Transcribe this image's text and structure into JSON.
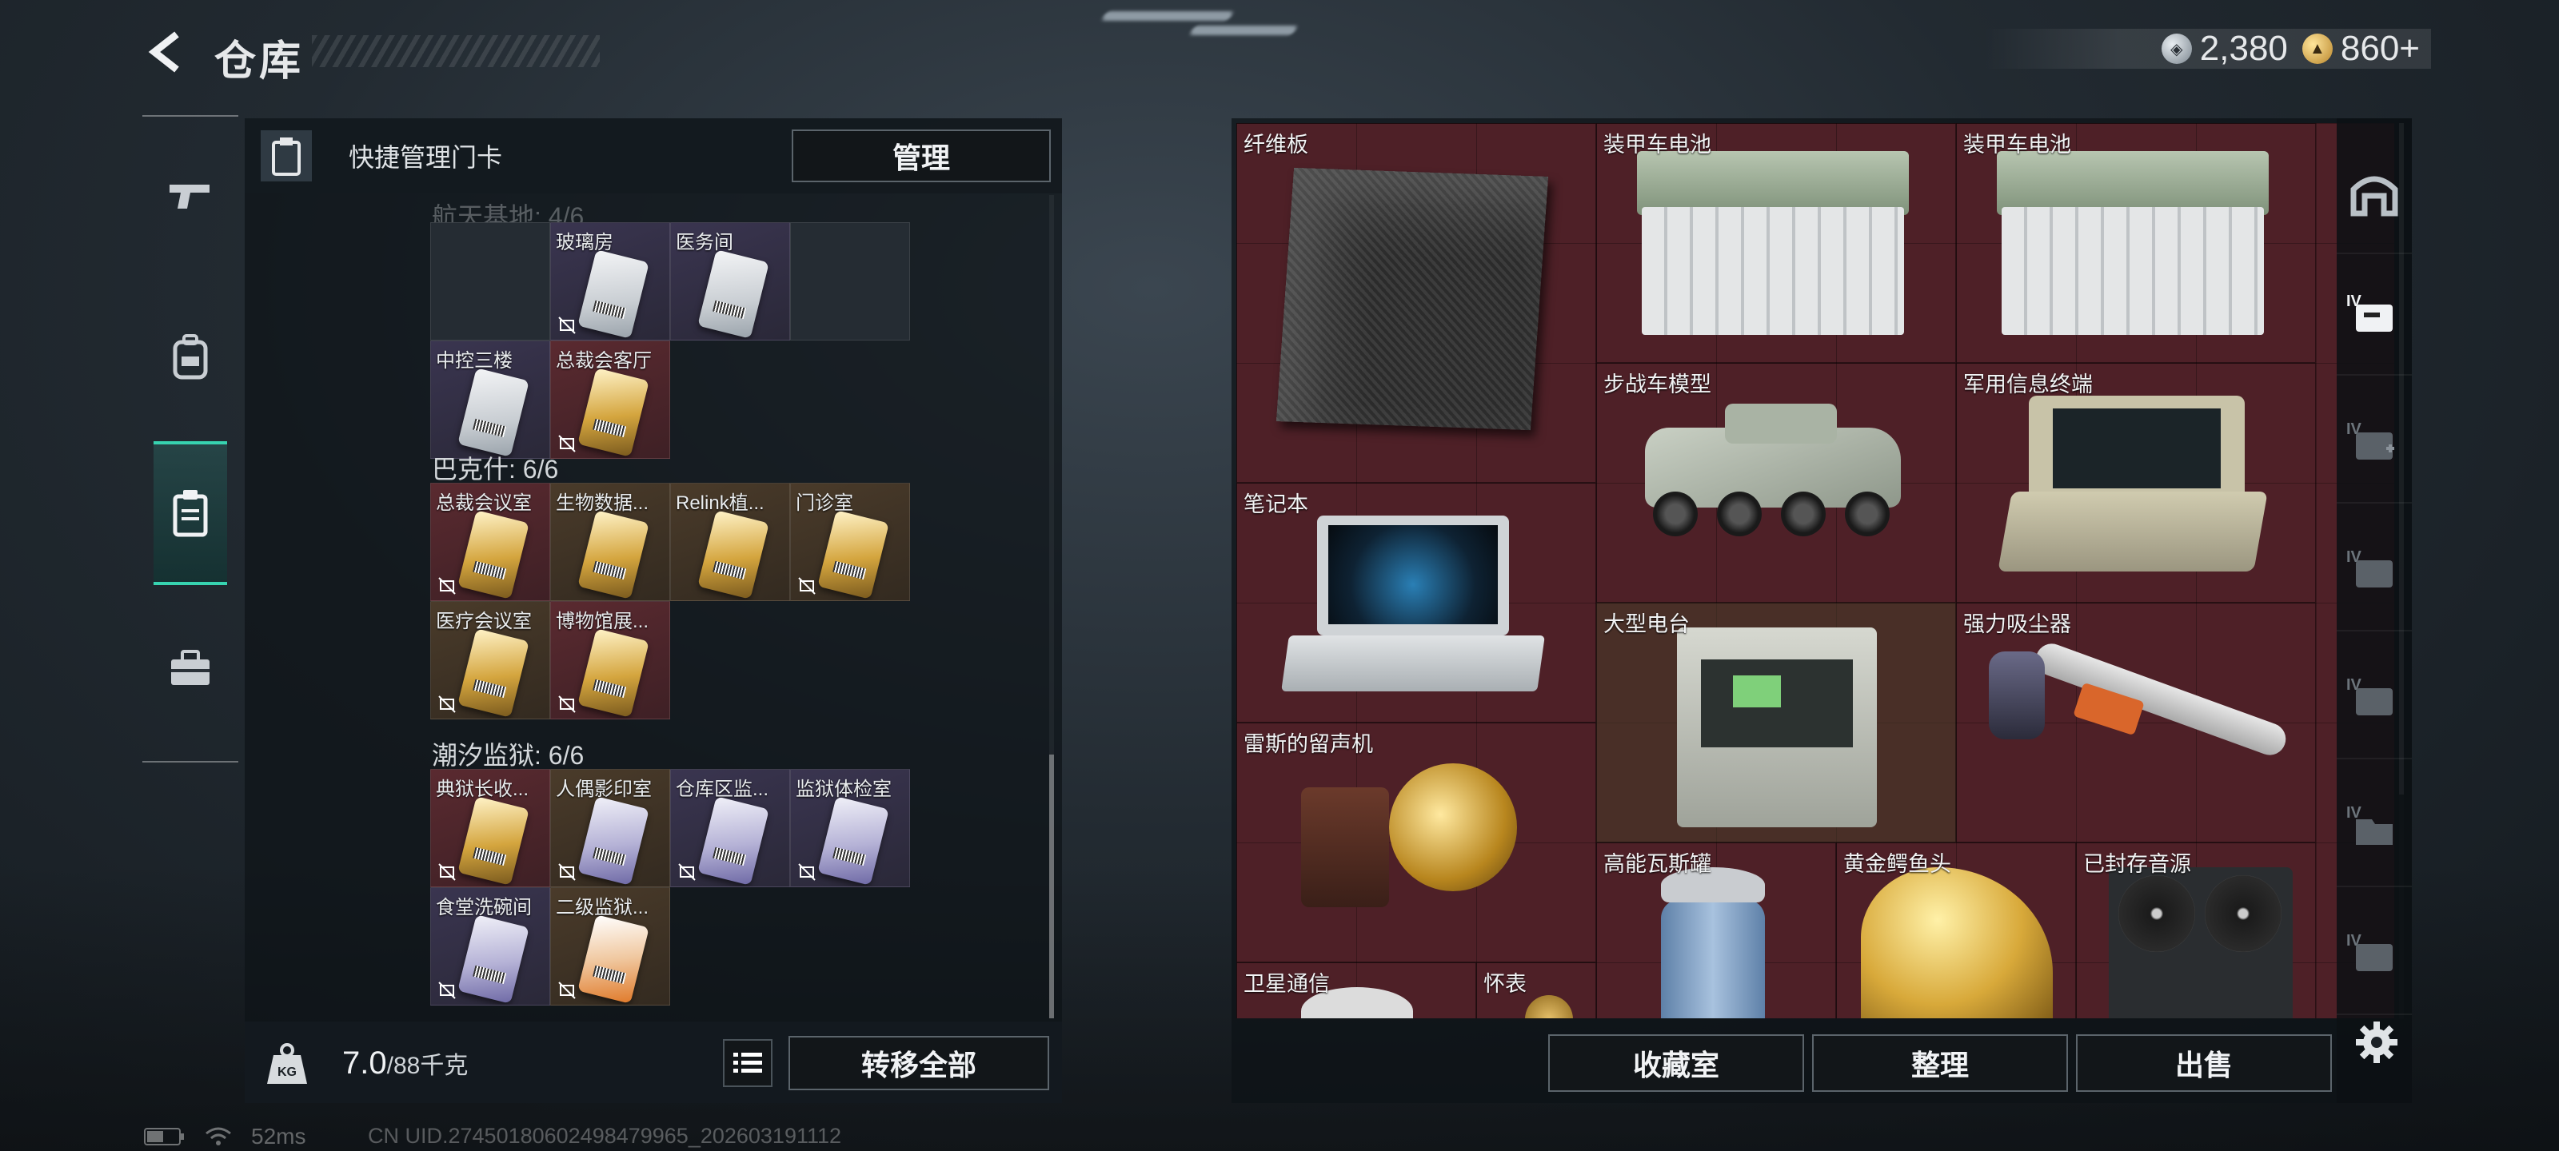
{
  "header": {
    "title": "仓库",
    "currencies": [
      {
        "icon": "silver-coin-icon",
        "value": "2,380"
      },
      {
        "icon": "gold-coin-icon",
        "value": "860+"
      }
    ]
  },
  "left_rail": {
    "tabs": [
      {
        "icon": "gun-icon",
        "active": false
      },
      {
        "icon": "backpack-icon",
        "active": false
      },
      {
        "icon": "keycard-holder-icon",
        "active": true
      },
      {
        "icon": "toolbox-icon",
        "active": false
      }
    ]
  },
  "left_panel": {
    "header_label": "快捷管理门卡",
    "manage_label": "管理",
    "partial_section_title": "航天基地: 4/6",
    "sections": [
      {
        "title": "",
        "cells": [
          {
            "name": "",
            "card": "",
            "bg": "empty",
            "lock": false
          },
          {
            "name": "玻璃房",
            "card": "white",
            "bg": "purple",
            "lock": true
          },
          {
            "name": "医务间",
            "card": "white",
            "bg": "purple",
            "lock": false
          },
          {
            "name": "",
            "card": "",
            "bg": "empty",
            "lock": false
          },
          {
            "name": "中控三楼",
            "card": "white",
            "bg": "purple",
            "lock": false
          },
          {
            "name": "总裁会客厅",
            "card": "gold",
            "bg": "red",
            "lock": true
          }
        ]
      },
      {
        "title": "巴克什: 6/6",
        "cells": [
          {
            "name": "总裁会议室",
            "card": "gold",
            "bg": "red",
            "lock": true
          },
          {
            "name": "生物数据...",
            "card": "gold",
            "bg": "gold",
            "lock": false
          },
          {
            "name": "Relink植...",
            "card": "gold",
            "bg": "gold",
            "lock": false
          },
          {
            "name": "门诊室",
            "card": "gold",
            "bg": "gold",
            "lock": true
          },
          {
            "name": "医疗会议室",
            "card": "gold",
            "bg": "gold",
            "lock": true
          },
          {
            "name": "博物馆展...",
            "card": "gold",
            "bg": "red",
            "lock": true
          }
        ]
      },
      {
        "title": "潮汐监狱: 6/6",
        "cells": [
          {
            "name": "典狱长收...",
            "card": "gold",
            "bg": "red",
            "lock": true
          },
          {
            "name": "人偶影印室",
            "card": "purple",
            "bg": "gold",
            "lock": true
          },
          {
            "name": "仓库区监...",
            "card": "purple",
            "bg": "purple",
            "lock": true
          },
          {
            "name": "监狱体检室",
            "card": "purple",
            "bg": "purple",
            "lock": true
          },
          {
            "name": "食堂洗碗间",
            "card": "purple",
            "bg": "purple",
            "lock": true
          },
          {
            "name": "二级监狱...",
            "card": "orange",
            "bg": "gold",
            "lock": true
          }
        ]
      }
    ],
    "footer": {
      "weight_value": "7.0",
      "weight_max": "/88千克",
      "transfer_label": "转移全部"
    }
  },
  "stash": {
    "items": [
      {
        "name": "纤维板",
        "visual": "carbon"
      },
      {
        "name": "装甲车电池",
        "visual": "battery"
      },
      {
        "name": "装甲车电池",
        "visual": "battery"
      },
      {
        "name": "步战车模型",
        "visual": "ifv"
      },
      {
        "name": "军用信息终端",
        "visual": "terminal"
      },
      {
        "name": "笔记本",
        "visual": "laptop"
      },
      {
        "name": "大型电台",
        "visual": "radio"
      },
      {
        "name": "强力吸尘器",
        "visual": "vacuum"
      },
      {
        "name": "雷斯的留声机",
        "visual": "phonograph"
      },
      {
        "name": "高能瓦斯罐",
        "visual": "gas"
      },
      {
        "name": "黄金鳄鱼头",
        "visual": "gold-croc"
      },
      {
        "name": "已封存音源",
        "visual": "reel"
      },
      {
        "name": "卫星通信",
        "visual": "satellite"
      },
      {
        "name": "怀表",
        "visual": "watch"
      }
    ],
    "buttons": {
      "collection": "收藏室",
      "sort": "整理",
      "sell": "出售"
    }
  },
  "right_rail": {
    "items": [
      {
        "icon": "home-base-icon"
      },
      {
        "icon": "level-iv-key-icon",
        "label": "IV"
      },
      {
        "icon": "level-iv-medkit-icon",
        "label": "IV"
      },
      {
        "icon": "level-iv-key-icon",
        "label": "IV"
      },
      {
        "icon": "level-iv-key-icon",
        "label": "IV"
      },
      {
        "icon": "level-iv-folder-icon",
        "label": "IV"
      },
      {
        "icon": "level-iv-key-icon",
        "label": "IV"
      }
    ],
    "settings_icon": "gear-icon"
  },
  "status": {
    "ping": "52ms",
    "uid": "CN UID.27450180602498479965_202603191112"
  }
}
